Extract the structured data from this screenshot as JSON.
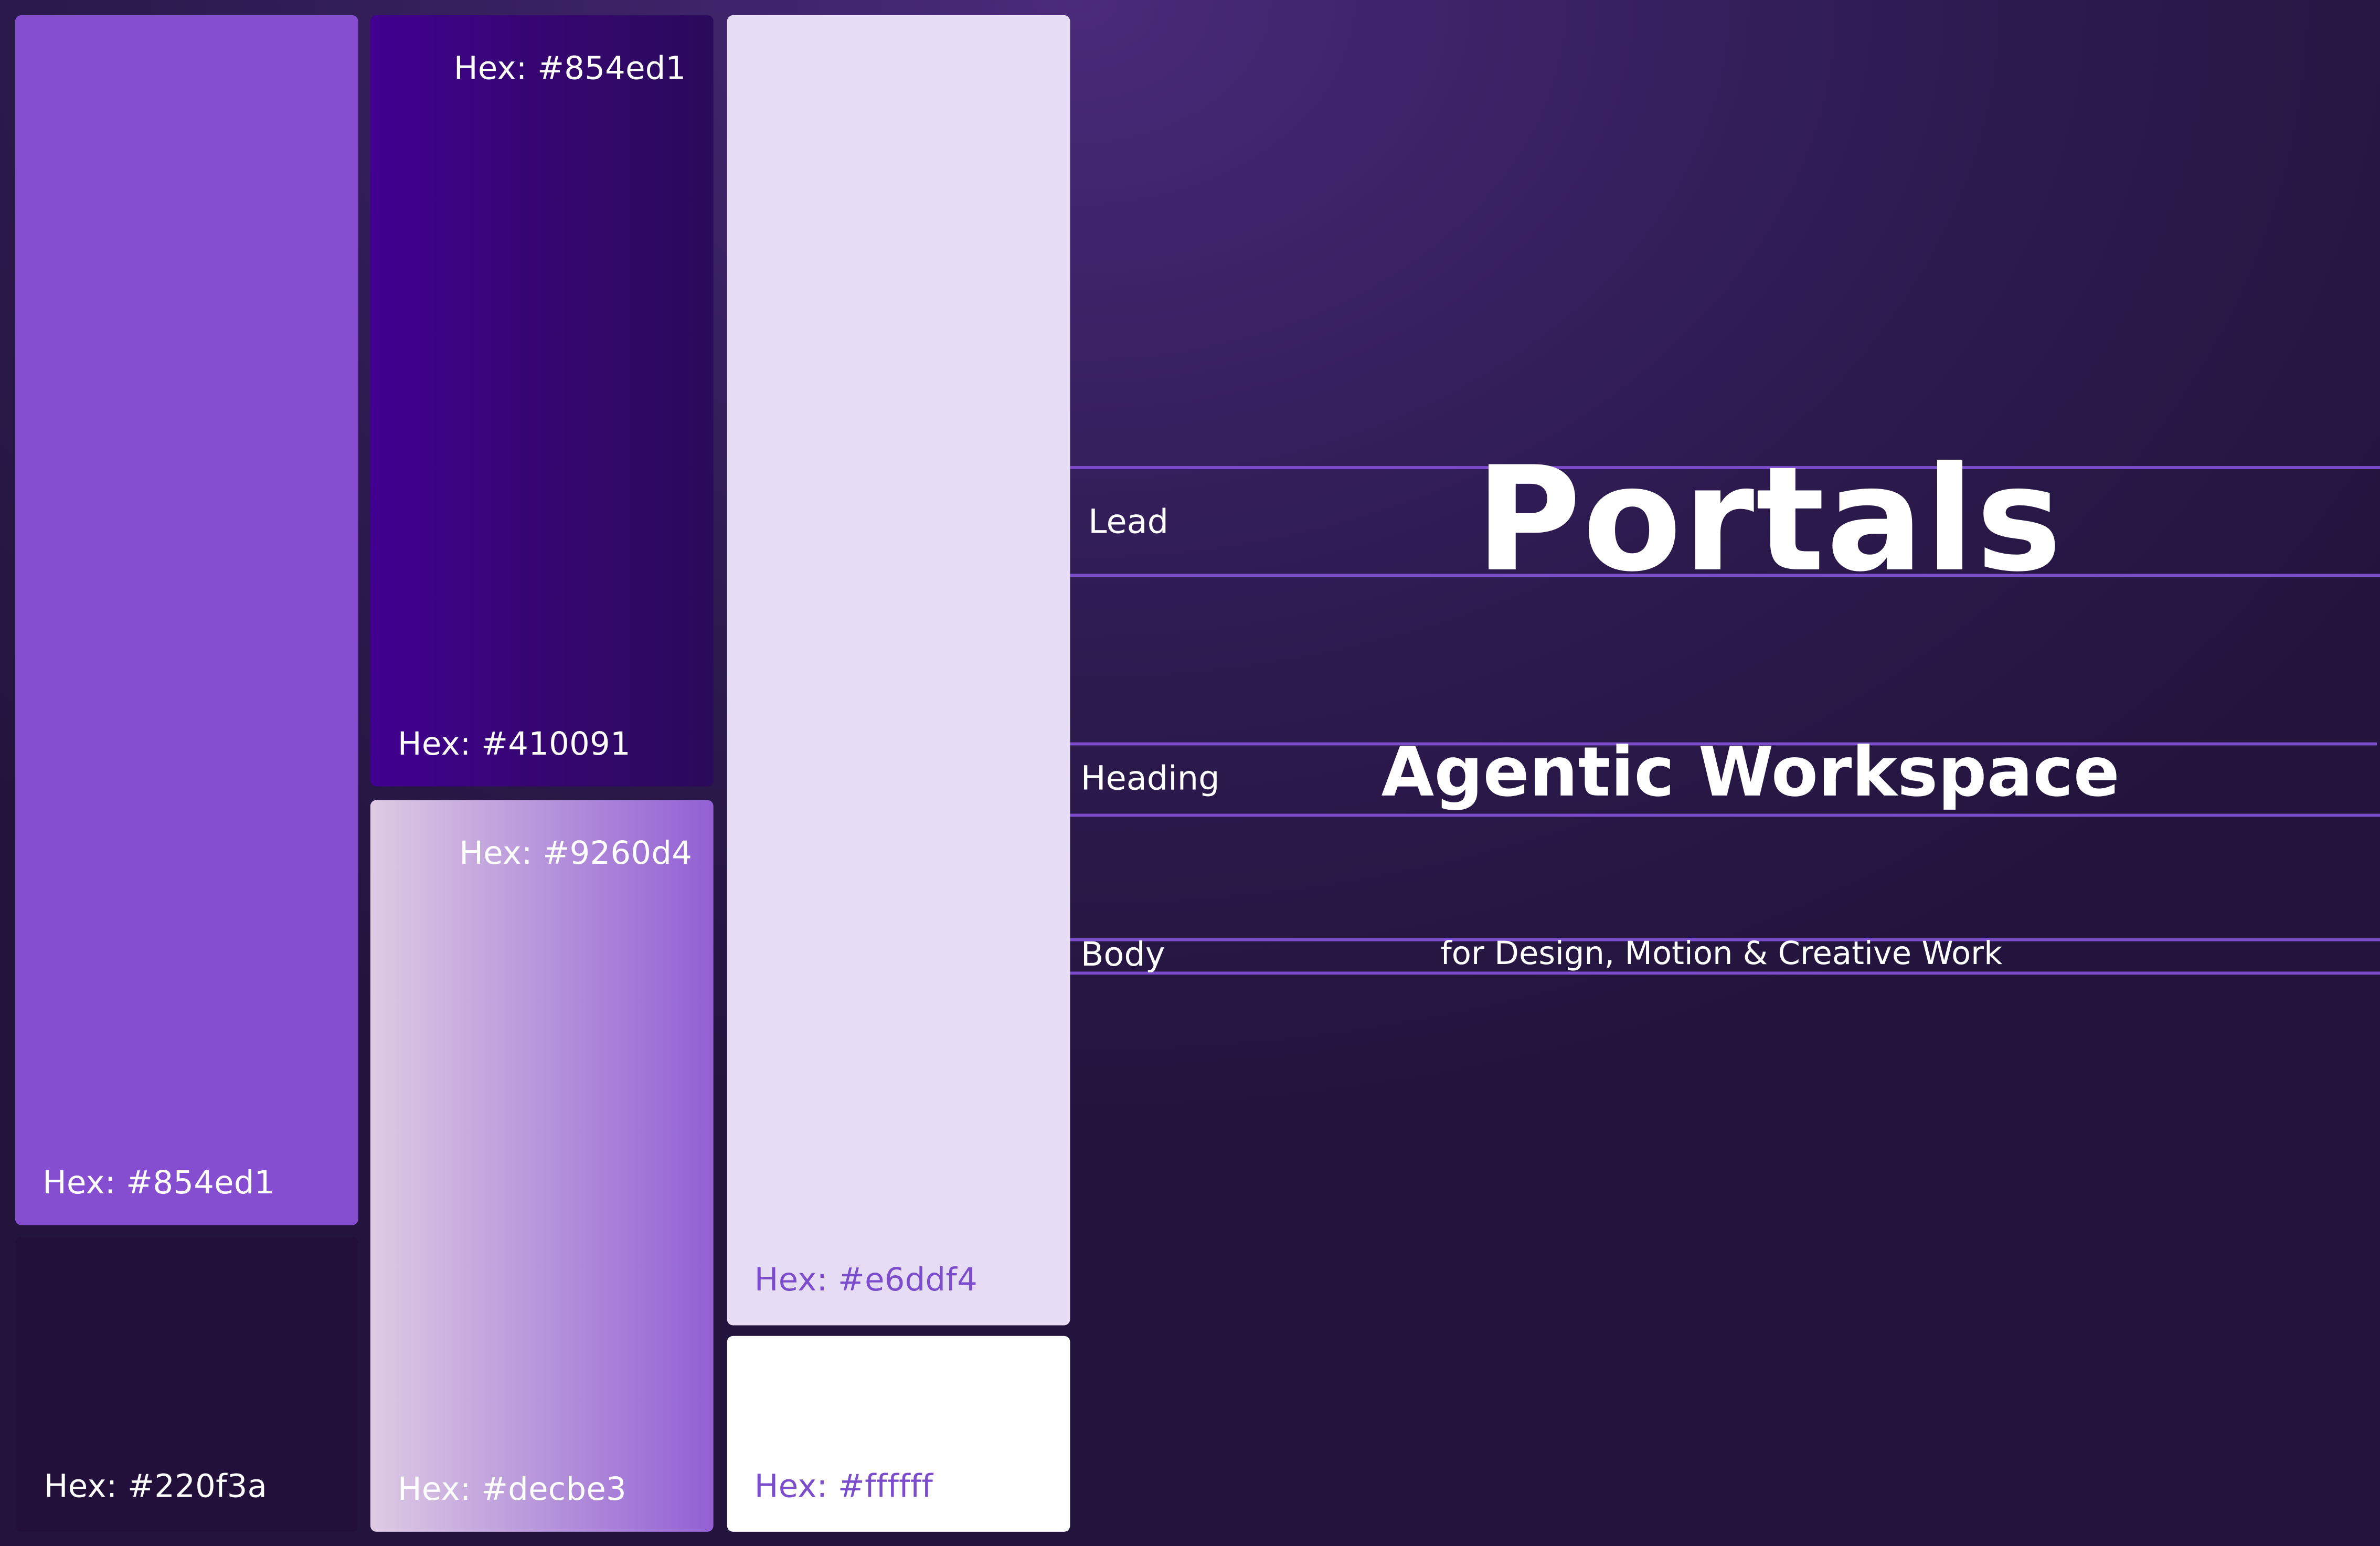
{
  "palette": {
    "swatches": [
      {
        "id": "s1",
        "label": "Hex: #854ed1",
        "fill": "#854ed1"
      },
      {
        "id": "s2",
        "label": "Hex: #220f3a",
        "fill": "#220f3a"
      },
      {
        "id": "s3",
        "label_top": "Hex: #854ed1",
        "label_bottom": "Hex: #410091",
        "fill_start": "#410091",
        "fill_end": "#2a0a5a"
      },
      {
        "id": "s4",
        "label_top": "Hex: #9260d4",
        "label_bottom": "Hex: #decbe3",
        "fill_start": "#decbe3",
        "fill_end": "#9260d4"
      },
      {
        "id": "s5",
        "label": "Hex: #e6ddf4",
        "fill": "#e6ddf4"
      },
      {
        "id": "s6",
        "label": "Hex: #ffffff",
        "fill": "#ffffff"
      }
    ],
    "label_color_light": "#ffffff",
    "label_color_accent": "#7b4ccc"
  },
  "typography": {
    "lead": {
      "label": "Lead",
      "sample": "Portals"
    },
    "heading": {
      "label": "Heading",
      "sample": "Agentic Workspace"
    },
    "body": {
      "label": "Body",
      "sample": "for Design, Motion & Creative Work"
    },
    "guide_color": "#7b4ccc"
  }
}
